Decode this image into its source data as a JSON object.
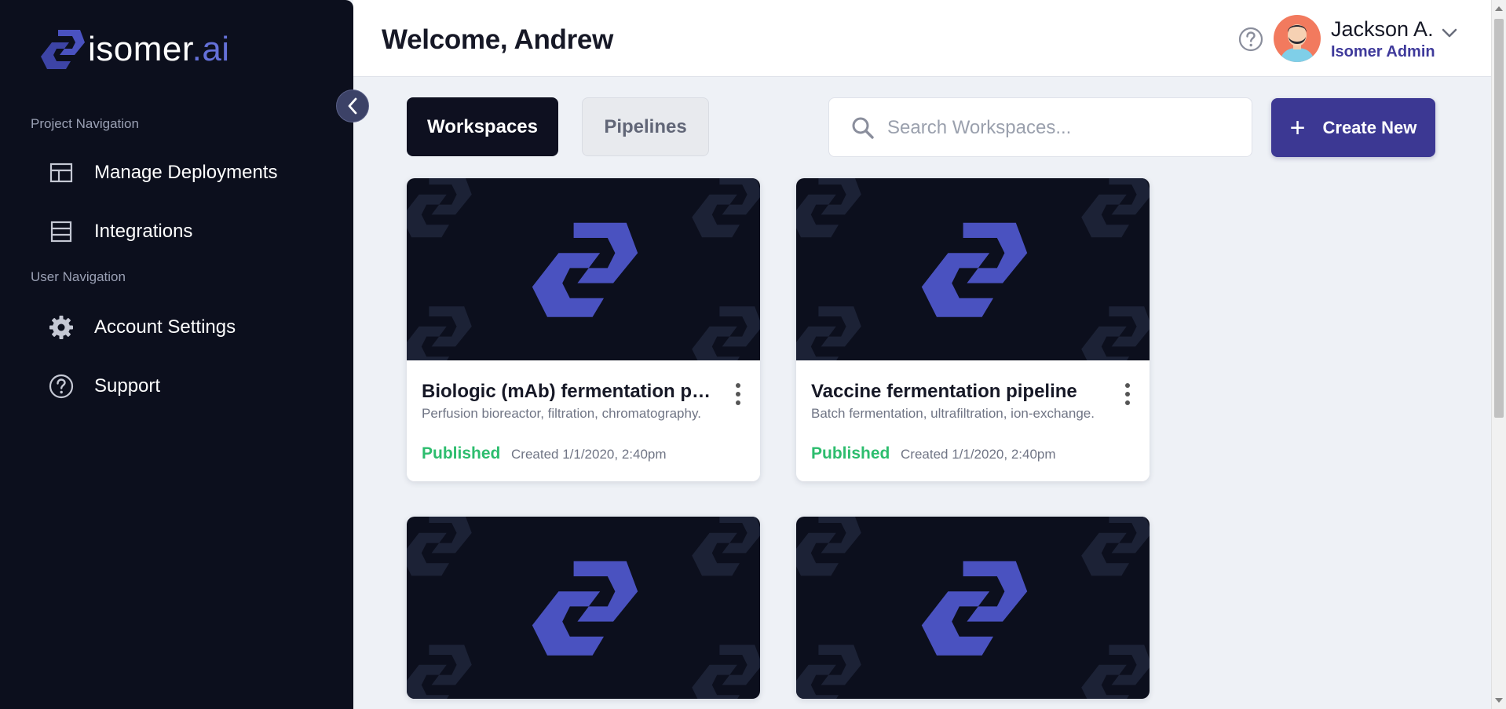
{
  "brand": {
    "name": "isomer",
    "suffix": ".ai"
  },
  "sidebar": {
    "sections": [
      {
        "label": "Project Navigation",
        "items": [
          {
            "label": "Manage Deployments",
            "icon": "table-layout-icon"
          },
          {
            "label": "Integrations",
            "icon": "list-icon"
          }
        ]
      },
      {
        "label": "User Navigation",
        "items": [
          {
            "label": "Account Settings",
            "icon": "gear-icon"
          },
          {
            "label": "Support",
            "icon": "help-circle-icon"
          }
        ]
      }
    ]
  },
  "header": {
    "welcome": "Welcome, Andrew",
    "user": {
      "name": "Jackson A.",
      "role": "Isomer Admin"
    }
  },
  "tabs": [
    {
      "label": "Workspaces",
      "active": true
    },
    {
      "label": "Pipelines",
      "active": false
    }
  ],
  "search": {
    "placeholder": "Search Workspaces..."
  },
  "create_button": {
    "label": "Create New"
  },
  "cards": [
    {
      "title": "Biologic (mAb) fermentation pipeline",
      "description": "Perfusion bioreactor, filtration, chromatography.",
      "status": "Published",
      "created": "Created 1/1/2020, 2:40pm"
    },
    {
      "title": "Vaccine fermentation pipeline",
      "description": "Batch fermentation, ultrafiltration, ion-exchange.",
      "status": "Published",
      "created": "Created 1/1/2020, 2:40pm"
    }
  ],
  "colors": {
    "sidebar_bg": "#0c0f1d",
    "accent": "#3c3893",
    "status_published": "#2dbd6e",
    "logo_blue": "#5059c9"
  }
}
